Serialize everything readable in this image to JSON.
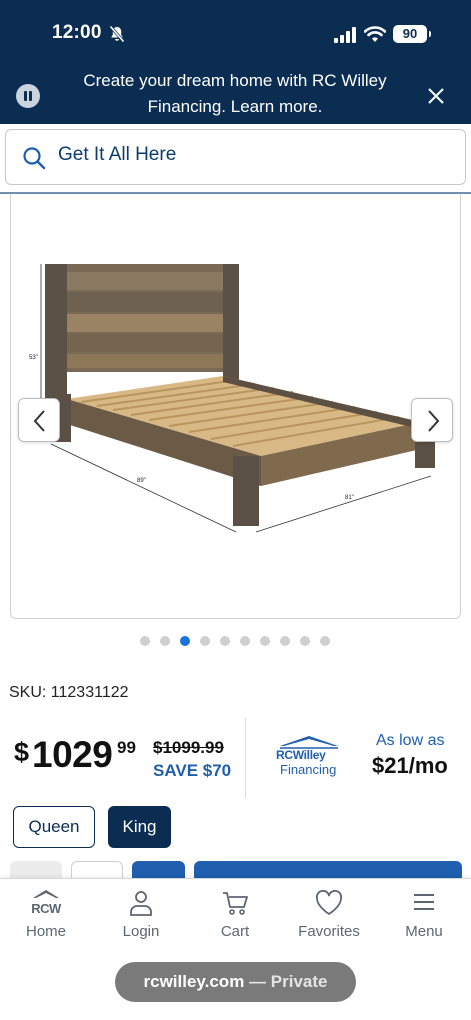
{
  "status_bar": {
    "time": "12:00",
    "battery": "90",
    "icons": [
      "bell-slash-icon",
      "signal-icon",
      "wifi-icon",
      "battery-icon"
    ]
  },
  "banner": {
    "text": "Create your dream home with RC Willey Financing. Learn more.",
    "icons": [
      "pause-icon",
      "close-icon"
    ]
  },
  "search": {
    "placeholder": "Get It All Here"
  },
  "product_image": {
    "dimension_labels": [
      "53\"",
      "89\"",
      "81\""
    ],
    "carousel_count": 10,
    "carousel_active_index": 2
  },
  "product": {
    "sku_label": "SKU:",
    "sku_value": "112331122",
    "price_symbol": "$",
    "price_whole": "1029",
    "price_cents": "99",
    "price_was": "$1099.99",
    "save_text": "SAVE $70"
  },
  "financing": {
    "logo_name": "RCWilley",
    "logo_sub": "Financing",
    "as_low_as": "As low as",
    "monthly": "$21/mo"
  },
  "sizes": {
    "options": [
      "Queen",
      "King"
    ],
    "selected": "King"
  },
  "bottom_nav": {
    "items": [
      {
        "label": "Home",
        "icon": "rcw-logo-icon",
        "logo_text": "RCW"
      },
      {
        "label": "Login",
        "icon": "user-icon"
      },
      {
        "label": "Cart",
        "icon": "cart-icon"
      },
      {
        "label": "Favorites",
        "icon": "heart-icon"
      },
      {
        "label": "Menu",
        "icon": "hamburger-icon"
      }
    ]
  },
  "browser": {
    "domain": "rcwilley.com",
    "separator": "—",
    "mode": "Private"
  },
  "colors": {
    "navy": "#0b2d52",
    "link_blue": "#1f5fae",
    "dot_active": "#1a73d9"
  }
}
